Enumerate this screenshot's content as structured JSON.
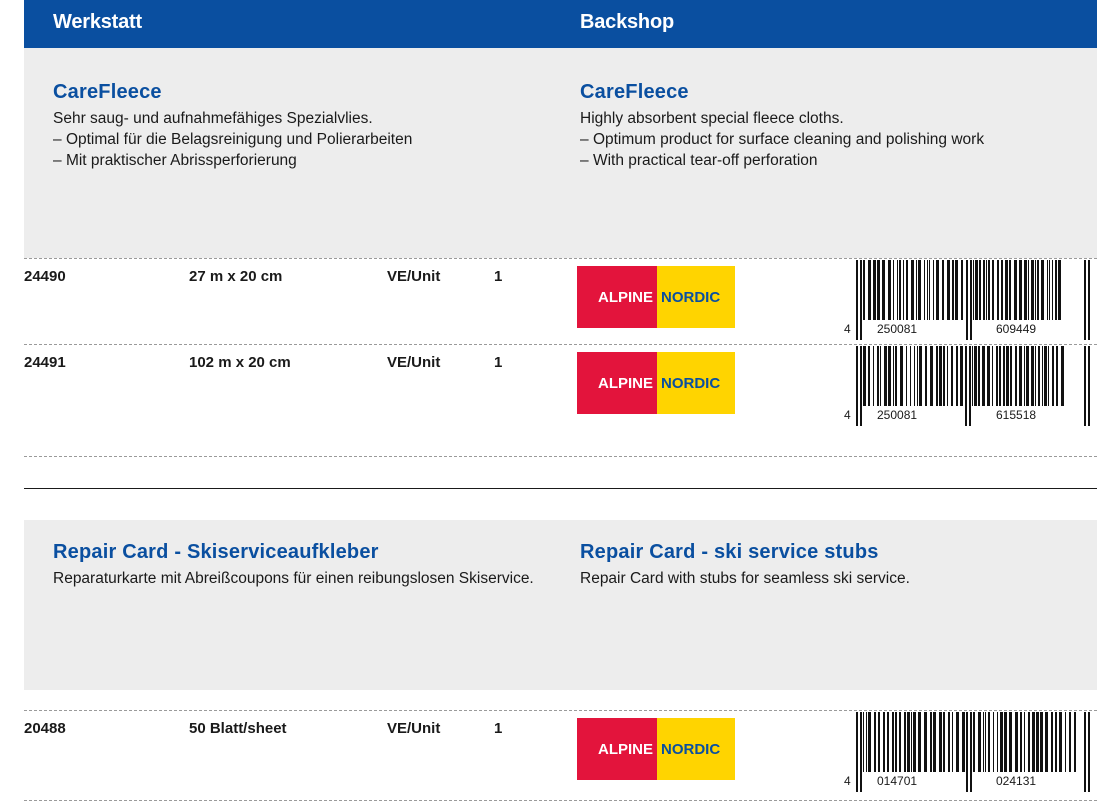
{
  "header": {
    "left": "Werkstatt",
    "right": "Backshop"
  },
  "sections": [
    {
      "de": {
        "title": "CareFleece",
        "desc": "Sehr saug- und aufnahmefähiges Spezialvlies.",
        "bullets": [
          "Optimal für die Belagsreinigung und Polierarbeiten",
          "Mit praktischer Abrissperforierung"
        ]
      },
      "en": {
        "title": "CareFleece",
        "desc": "Highly absorbent special fleece cloths.",
        "bullets": [
          "Optimum product for surface cleaning and polishing work",
          "With practical tear-off perforation"
        ]
      },
      "products": [
        {
          "sku": "24490",
          "size": "27 m x 20 cm",
          "unit_label": "VE/Unit",
          "qty": "1",
          "badge_left": "ALPINE",
          "badge_right": "NORDIC",
          "barcode_first": "4",
          "barcode_left": "250081",
          "barcode_right": "609449"
        },
        {
          "sku": "24491",
          "size": "102 m x 20 cm",
          "unit_label": "VE/Unit",
          "qty": "1",
          "badge_left": "ALPINE",
          "badge_right": "NORDIC",
          "barcode_first": "4",
          "barcode_left": "250081",
          "barcode_right": "615518"
        }
      ]
    },
    {
      "de": {
        "title": "Repair Card - Skiserviceaufkleber",
        "desc": "Reparaturkarte mit Abreißcoupons für einen reibungslosen Skiservice."
      },
      "en": {
        "title": "Repair Card - ski service stubs",
        "desc": "Repair Card with stubs for seamless ski service."
      },
      "products": [
        {
          "sku": "20488",
          "size": "50 Blatt/sheet",
          "unit_label": "VE/Unit",
          "qty": "1",
          "badge_left": "ALPINE",
          "badge_right": "NORDIC",
          "barcode_first": "4",
          "barcode_left": "014701",
          "barcode_right": "024131"
        }
      ]
    }
  ],
  "colors": {
    "brand_blue": "#0a4fa0",
    "panel_grey": "#ededed",
    "alpine_red": "#e3143c",
    "nordic_yellow": "#ffd400"
  }
}
